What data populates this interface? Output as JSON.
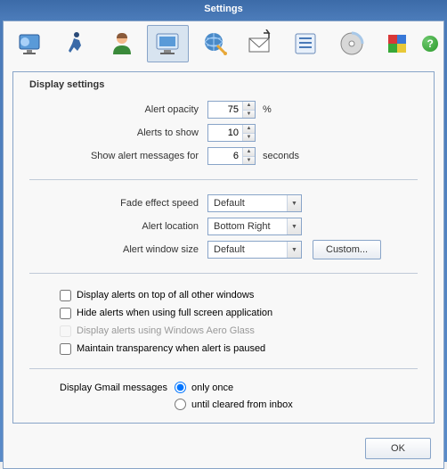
{
  "title": "Settings",
  "panelTitle": "Display settings",
  "labels": {
    "opacity": "Alert opacity",
    "toShow": "Alerts to show",
    "showFor": "Show alert messages for",
    "fade": "Fade effect speed",
    "location": "Alert location",
    "winsize": "Alert window size",
    "seconds": "seconds",
    "percent": "%",
    "custom": "Custom...",
    "gmail": "Display Gmail messages"
  },
  "values": {
    "opacity": "75",
    "toShow": "10",
    "showFor": "6",
    "fade": "Default",
    "location": "Bottom Right",
    "winsize": "Default"
  },
  "checks": {
    "onTop": "Display alerts on top of all other windows",
    "fullscreen": "Hide alerts when using full screen application",
    "aero": "Display alerts using Windows Aero Glass",
    "transparency": "Maintain transparency when alert is paused"
  },
  "radio": {
    "once": "only once",
    "until": "until cleared from inbox"
  },
  "buttons": {
    "ok": "OK"
  },
  "help": "?"
}
